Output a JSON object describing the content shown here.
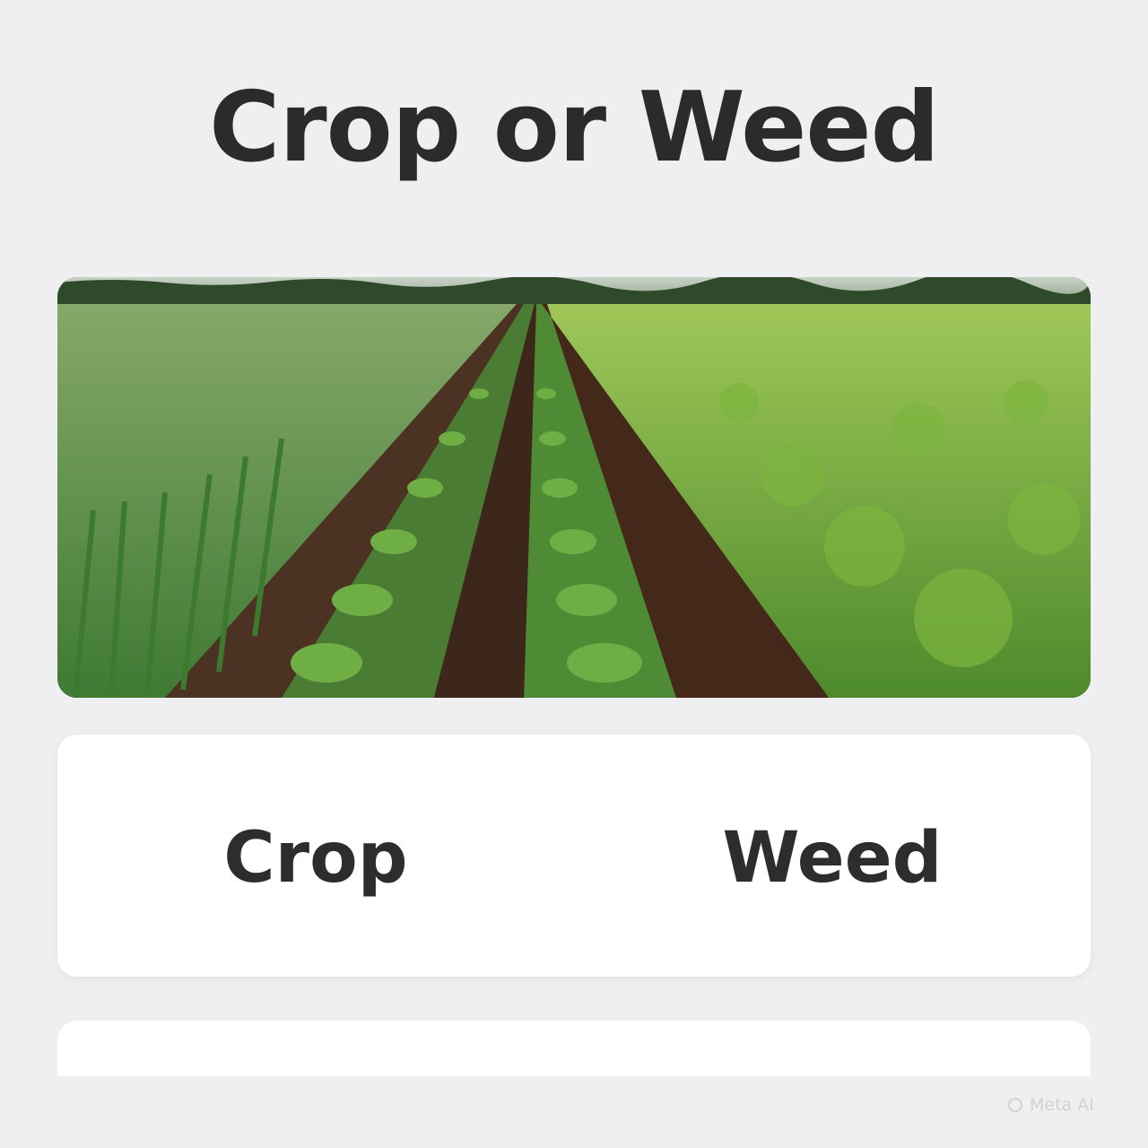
{
  "title": "Crop or Weed",
  "photo": {
    "description_icon": "field-photo"
  },
  "answers": {
    "crop_label": "Crop",
    "weed_label": "Weed"
  },
  "watermark": {
    "label": "Meta AI"
  },
  "colors": {
    "background": "#efeff1",
    "card": "#ffffff",
    "text": "#2b2b2b",
    "soil": "#3b2518",
    "leaf": "#5f9a36"
  }
}
